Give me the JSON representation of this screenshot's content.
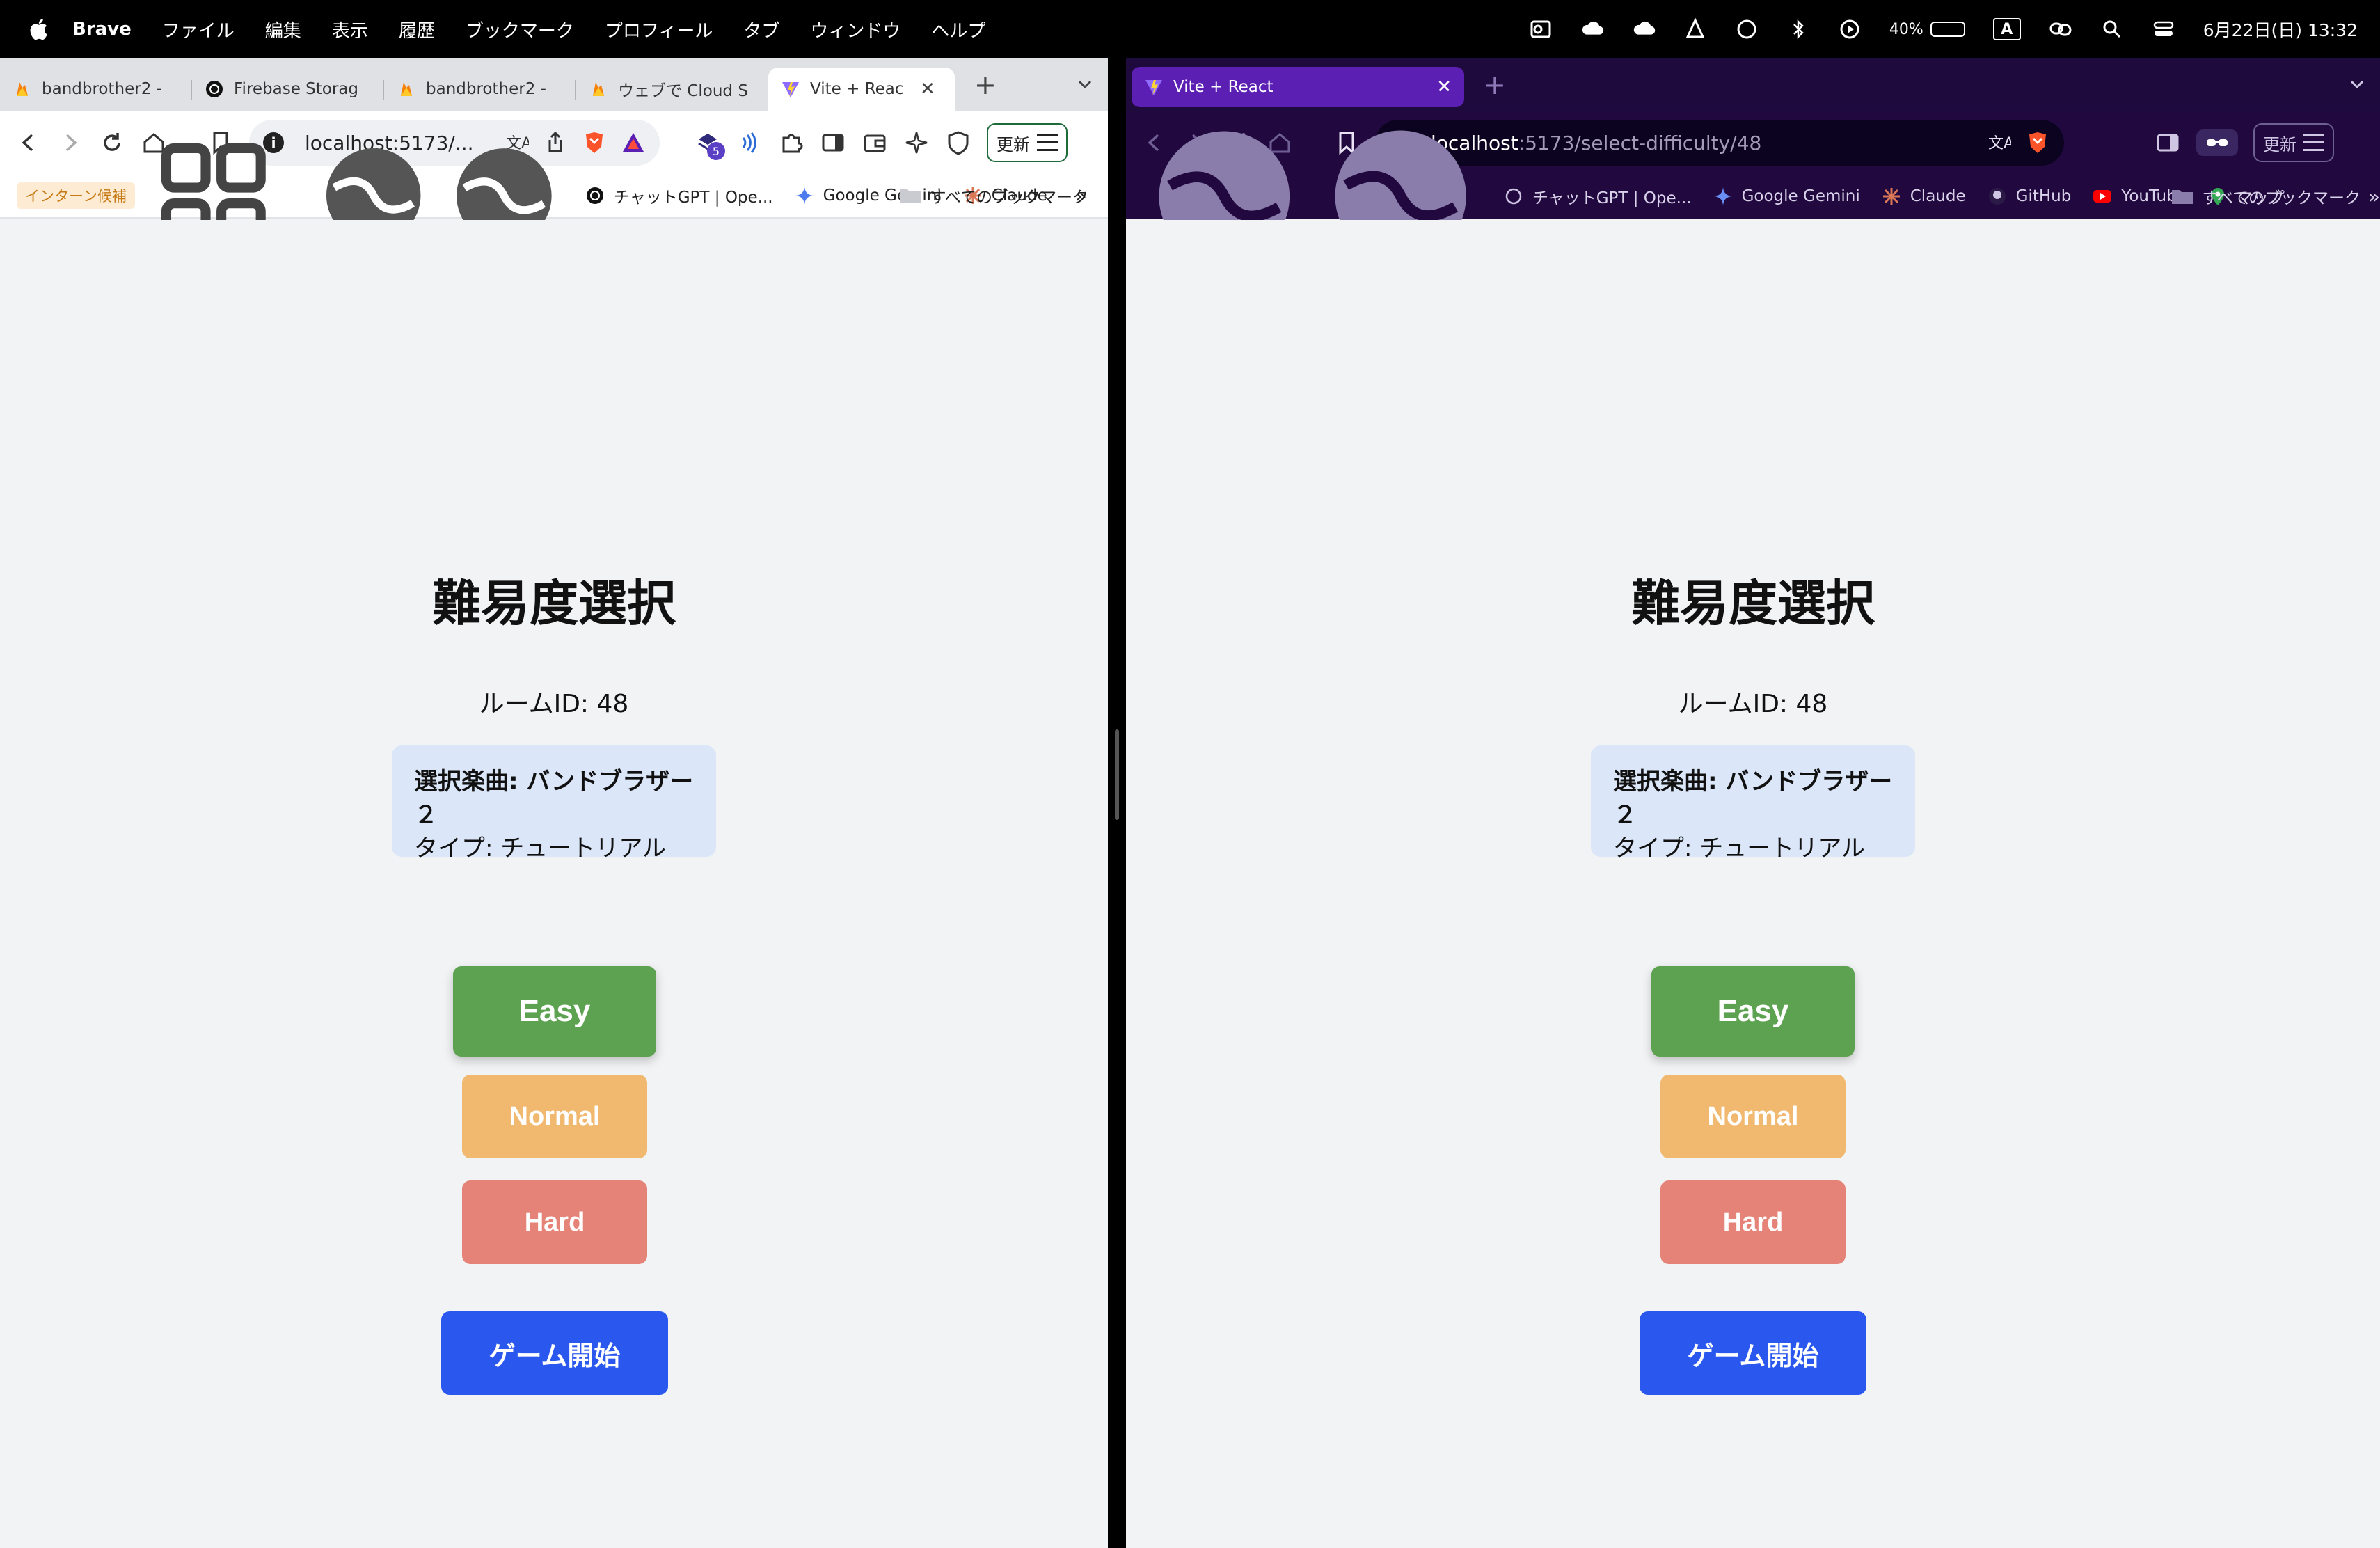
{
  "menubar": {
    "app_name": "Brave",
    "items": [
      "ファイル",
      "編集",
      "表示",
      "履歴",
      "ブックマーク",
      "プロフィール",
      "タブ",
      "ウィンドウ",
      "ヘルプ"
    ],
    "battery_percent": "40%",
    "input_mode": "A",
    "datetime": "6月22日(日) 13:32"
  },
  "left_window": {
    "tabs": [
      {
        "title": "bandbrother2 -",
        "icon": "firebase-icon"
      },
      {
        "title": "Firebase Storag",
        "icon": "openai-icon"
      },
      {
        "title": "bandbrother2 -",
        "icon": "firebase-icon"
      },
      {
        "title": "ウェブで Cloud S",
        "icon": "firebase-icon"
      },
      {
        "title": "Vite + Reac",
        "icon": "vite-icon",
        "active": true
      }
    ],
    "url_host": "localhost:5173/...",
    "extension_badge": "5",
    "update_label": "更新",
    "bookmarks": {
      "tag": "インターン候補",
      "items": [
        "チャットGPT | Ope...",
        "Google Gemini",
        "Claude"
      ],
      "more": "»",
      "all_label": "すべてのブックマーク"
    }
  },
  "right_window": {
    "tabs": [
      {
        "title": "Vite + React",
        "icon": "vite-icon",
        "active": true
      }
    ],
    "url_host": "localhost",
    "url_path": ":5173/select-difficulty/48",
    "update_label": "更新",
    "bookmarks": {
      "items": [
        "チャットGPT | Ope...",
        "Google Gemini",
        "Claude",
        "GitHub",
        "YouTube",
        "マップ"
      ],
      "more": "»",
      "all_label": "すべてのブックマーク"
    }
  },
  "app": {
    "heading": "難易度選択",
    "room_label": "ルームID: 48",
    "song_label": "選択楽曲: バンドブラザー２",
    "type_label": "タイプ: チュートリアル",
    "buttons": {
      "easy": "Easy",
      "normal": "Normal",
      "hard": "Hard",
      "start": "ゲーム開始"
    },
    "colors": {
      "easy": "#5da251",
      "normal": "#f1b86f",
      "hard": "#e58378",
      "start": "#2a58ef",
      "song_box": "#dbe6f8"
    }
  }
}
